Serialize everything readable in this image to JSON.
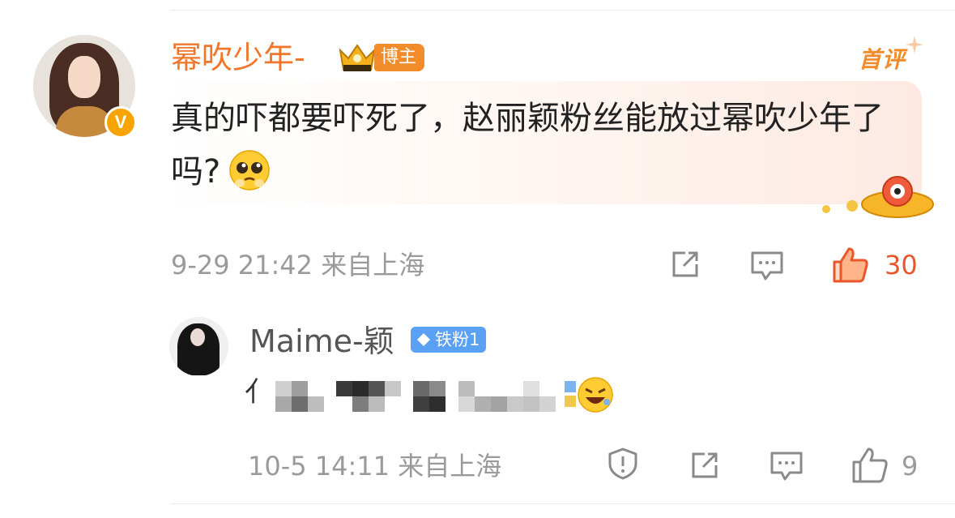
{
  "comment": {
    "username": "幂吹少年-",
    "badge": "博主",
    "tag": "首评",
    "text": "真的吓都要吓死了，赵丽颖粉丝能放过幂吹少年了吗?",
    "time": "9-29 21:42",
    "location": "来自上海",
    "likes": "30",
    "colors": {
      "accent": "#f0762a",
      "like": "#e8562a",
      "text": "#222222",
      "meta": "#9a9a9a"
    }
  },
  "reply": {
    "username": "Maime-颖",
    "fan_badge": "铁粉1",
    "text_visible": "亻",
    "time": "10-5 14:11",
    "location": "来自上海",
    "likes": "9",
    "colors": {
      "fan_badge": "#5aa1f3",
      "name": "#555555"
    }
  },
  "icons": [
    "vip-v-icon",
    "crown-icon",
    "share-icon",
    "comment-icon",
    "like-icon",
    "report-icon",
    "gem-icon",
    "pleading-face-emoji",
    "laughing-face-emoji",
    "ufo-sticker"
  ]
}
